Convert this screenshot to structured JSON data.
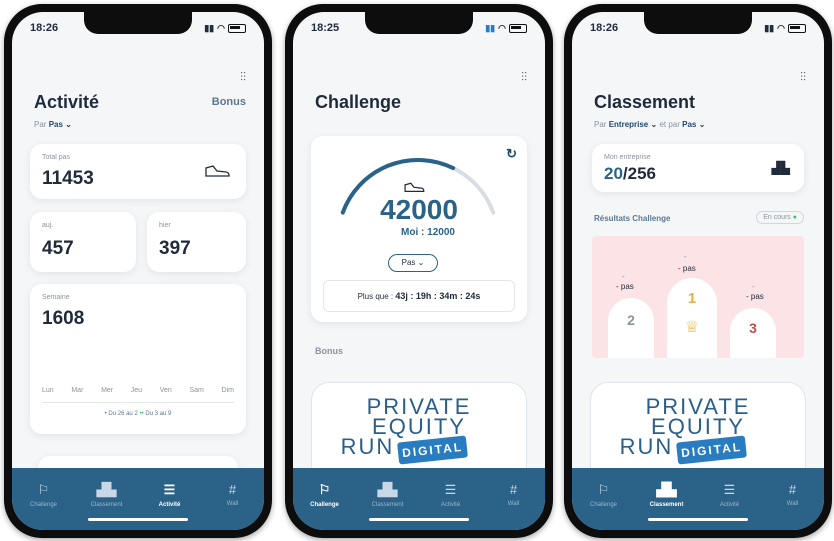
{
  "status_times": [
    "18:26",
    "18:25",
    "18:26"
  ],
  "phone1": {
    "title": "Activité",
    "bonus_link": "Bonus",
    "filter_prefix": "Par",
    "filter_value": "Pas",
    "total_label": "Total pas",
    "total_value": "11453",
    "today_label": "auj.",
    "today_value": "457",
    "yesterday_label": "hier",
    "yesterday_value": "397",
    "week_label": "Semaine",
    "week_value": "1608",
    "days": [
      "Lun",
      "Mar",
      "Mer",
      "Jeu",
      "Ven",
      "Sam",
      "Dim"
    ],
    "legend_prev": "Du 26 au 2",
    "legend_cur": "Du 3 au 9"
  },
  "phone2": {
    "title": "Challenge",
    "goal_value": "42000",
    "me_label": "Moi : 12000",
    "unit_select": "Pas",
    "remaining_prefix": "Plus que :",
    "remaining_value": "43j : 19h : 34m : 24s",
    "bonus_section": "Bonus",
    "progress_fraction": 0.2857
  },
  "phone3": {
    "title": "Classement",
    "filter_prefix": "Par",
    "filter_value": "Entreprise",
    "filter_mid": "et par",
    "filter_value2": "Pas",
    "company_label": "Mon entreprise",
    "company_rank": "20",
    "company_total": "/256",
    "results_label": "Résultats Challenge",
    "status_badge": "En cours",
    "podium": {
      "first_steps": "- pas",
      "second_steps": "- pas",
      "third_steps": "- pas",
      "first": "1",
      "second": "2",
      "third": "3",
      "dot": "-"
    }
  },
  "logo": {
    "line1": "PRIVATE",
    "line2": "EQUITY",
    "line3": "RUN",
    "badge": "DIGITAL"
  },
  "nav": {
    "challenge": "Challenge",
    "classement": "Classement",
    "activite": "Activité",
    "wall": "Wall"
  },
  "colors": {
    "primary": "#2a6288",
    "accent": "#2a7cc1",
    "podium_bg": "#fbe3e6",
    "gold": "#e1b33c",
    "status_green": "#3cc46a"
  },
  "icons": {
    "filter": "sliders-icon",
    "shoe": "sneaker-icon",
    "refresh": "refresh-icon",
    "rank": "podium-icon",
    "nav_challenge": "flag-icon",
    "nav_classement": "podium-icon",
    "nav_activite": "list-icon",
    "nav_wall": "hash-icon"
  }
}
